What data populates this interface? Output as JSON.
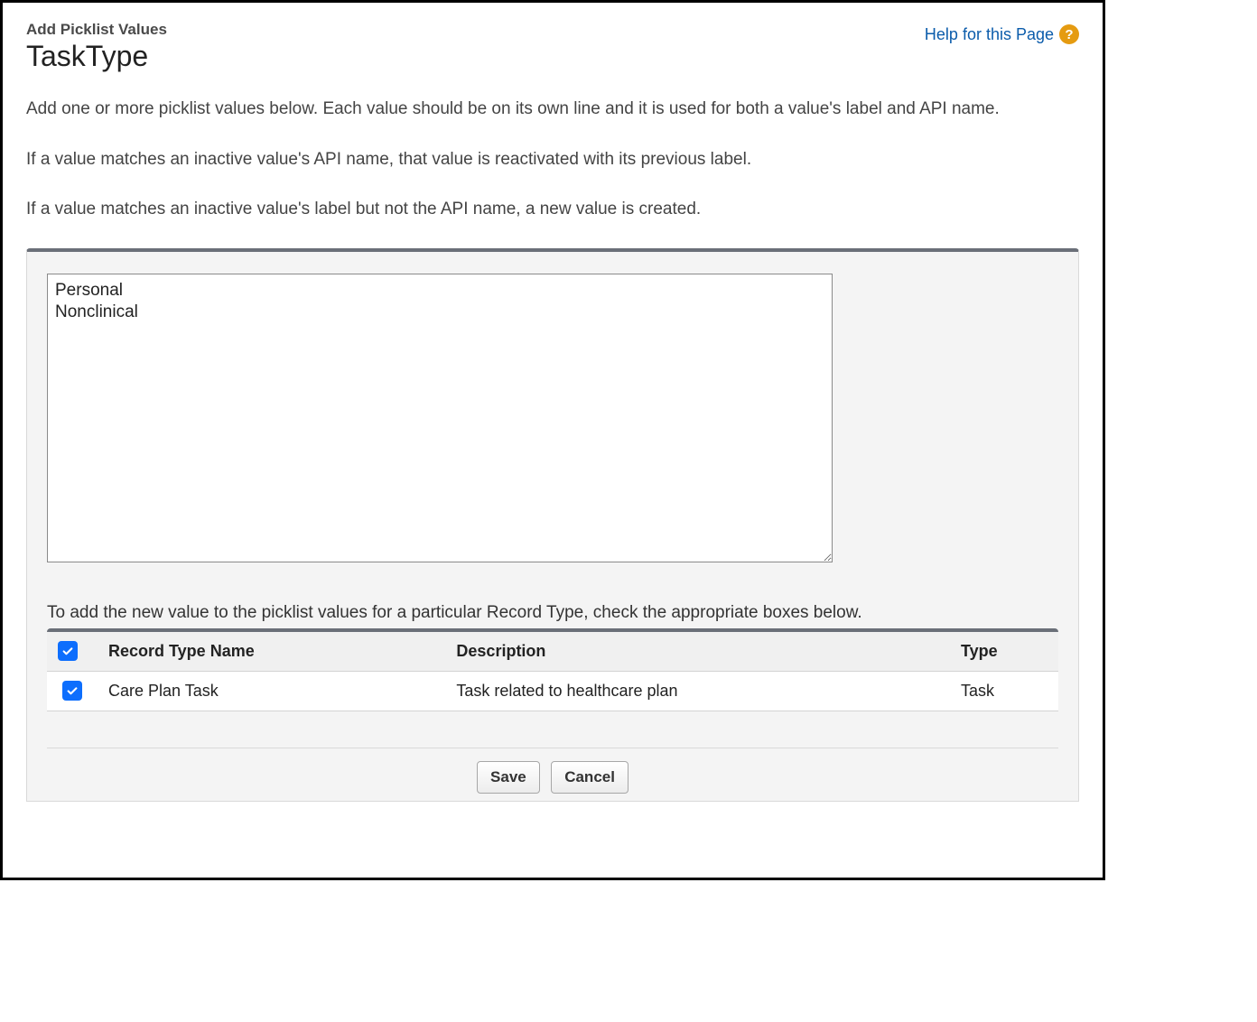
{
  "header": {
    "subtitle": "Add Picklist Values",
    "title": "TaskType",
    "help_label": "Help for this Page",
    "help_icon_char": "?"
  },
  "description": {
    "p1": "Add one or more picklist values below. Each value should be on its own line and it is used for both a value's label and API name.",
    "p2": "If a value matches an inactive value's API name, that value is reactivated with its previous label.",
    "p3": "If a value matches an inactive value's label but not the API name, a new value is created."
  },
  "textarea": {
    "value": "Personal\nNonclinical"
  },
  "recordTypes": {
    "intro": "To add the new value to the picklist values for a particular Record Type, check the appropriate boxes below.",
    "columns": {
      "name": "Record Type Name",
      "description": "Description",
      "type": "Type"
    },
    "rows": [
      {
        "checked": true,
        "name": "Care Plan Task",
        "description": "Task related to healthcare plan",
        "type": "Task"
      }
    ],
    "select_all_checked": true
  },
  "buttons": {
    "save": "Save",
    "cancel": "Cancel"
  }
}
